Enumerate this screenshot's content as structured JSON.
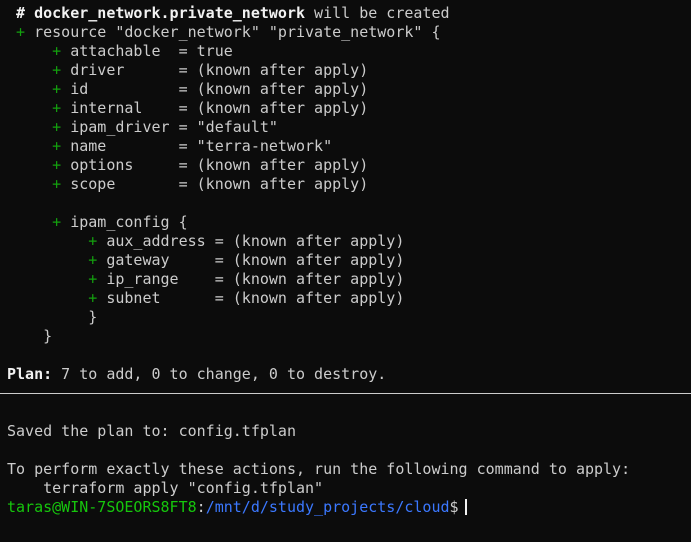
{
  "colors": {
    "background": "#0c0c0c",
    "text": "#cccccc",
    "plus": "#13a10e",
    "prompt_user": "#16c60c",
    "prompt_path": "#3b78ff"
  },
  "plan_block": {
    "comment_hash": "#",
    "comment_resource": "docker_network.private_network",
    "comment_suffix": " will be created",
    "plus": "+",
    "resource_line": "resource \"docker_network\" \"private_network\" {",
    "attributes": [
      {
        "text": "attachable  = true"
      },
      {
        "text": "driver      = (known after apply)"
      },
      {
        "text": "id          = (known after apply)"
      },
      {
        "text": "internal    = (known after apply)"
      },
      {
        "text": "ipam_driver = \"default\""
      },
      {
        "text": "name        = \"terra-network\""
      },
      {
        "text": "options     = (known after apply)"
      },
      {
        "text": "scope       = (known after apply)"
      }
    ],
    "ipam_open": "ipam_config {",
    "ipam_attributes": [
      {
        "text": "aux_address = (known after apply)"
      },
      {
        "text": "gateway     = (known after apply)"
      },
      {
        "text": "ip_range    = (known after apply)"
      },
      {
        "text": "subnet      = (known after apply)"
      }
    ],
    "close_brace": "}"
  },
  "summary": {
    "label": "Plan:",
    "text": " 7 to add, 0 to change, 0 to destroy."
  },
  "saved": {
    "text": "Saved the plan to: config.tfplan"
  },
  "instructions": {
    "line1": "To perform exactly these actions, run the following command to apply:",
    "command": "terraform apply \"config.tfplan\""
  },
  "prompt": {
    "user_host": "taras@WIN-7SOEORS8FT8",
    "colon": ":",
    "path": "/mnt/d/study_projects/cloud",
    "symbol": "$"
  }
}
